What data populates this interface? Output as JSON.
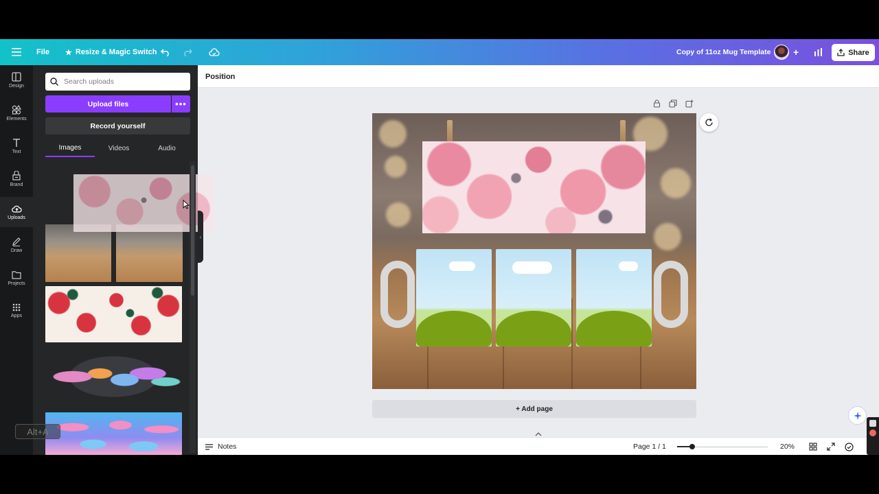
{
  "topbar": {
    "file_label": "File",
    "resize_label": "Resize & Magic Switch",
    "design_title": "Copy of 11oz Mug Template",
    "share_label": "Share"
  },
  "rail": {
    "items": [
      {
        "label": "Design",
        "icon": "design-icon"
      },
      {
        "label": "Elements",
        "icon": "elements-icon"
      },
      {
        "label": "Text",
        "icon": "text-icon"
      },
      {
        "label": "Brand",
        "icon": "brand-icon"
      },
      {
        "label": "Uploads",
        "icon": "upload-cloud-icon"
      },
      {
        "label": "Draw",
        "icon": "draw-icon"
      },
      {
        "label": "Projects",
        "icon": "folder-icon"
      },
      {
        "label": "Apps",
        "icon": "apps-grid-icon"
      }
    ],
    "active": "Uploads"
  },
  "panel": {
    "search_placeholder": "Search uploads",
    "upload_label": "Upload files",
    "record_label": "Record yourself",
    "tabs": [
      "Images",
      "Videos",
      "Audio"
    ],
    "active_tab": "Images",
    "thumbnails": [
      "pink-floral-pattern",
      "wood-table-bokeh-1",
      "wood-table-bokeh-2",
      "strawberry-pattern",
      "watercolor-flower-bouquet",
      "pink-dolphins-pattern"
    ]
  },
  "workspace": {
    "position_label": "Position",
    "add_page_label": "+ Add page"
  },
  "bottombar": {
    "notes_label": "Notes",
    "page_indicator": "Page 1 / 1",
    "zoom_label": "20%",
    "zoom_value": 0.2
  },
  "overlay": {
    "watermark_text": "Alt+A"
  },
  "colors": {
    "accent_purple": "#8b3dff",
    "topbar_start": "#12c2c9",
    "topbar_end": "#7a4fe0"
  }
}
